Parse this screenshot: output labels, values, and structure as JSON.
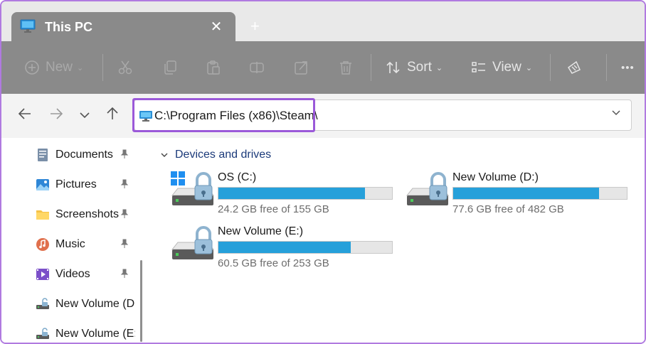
{
  "tab": {
    "title": "This PC",
    "close": "✕",
    "new_tab": "+"
  },
  "toolbar": {
    "new_label": "New",
    "sort_label": "Sort",
    "view_label": "View",
    "more_label": "•••"
  },
  "address": {
    "path": "C:\\Program Files (x86)\\Steam\\"
  },
  "sidebar": {
    "items": [
      {
        "label": "Documents",
        "icon": "documents-icon",
        "pinned": true
      },
      {
        "label": "Pictures",
        "icon": "pictures-icon",
        "pinned": true
      },
      {
        "label": "Screenshots",
        "icon": "folder-icon",
        "pinned": true
      },
      {
        "label": "Music",
        "icon": "music-icon",
        "pinned": true
      },
      {
        "label": "Videos",
        "icon": "videos-icon",
        "pinned": true
      },
      {
        "label": "New Volume (D",
        "icon": "drive-icon",
        "pinned": false
      },
      {
        "label": "New Volume (E:",
        "icon": "drive-icon",
        "pinned": false
      }
    ]
  },
  "main": {
    "group_title": "Devices and drives",
    "drives": [
      {
        "name": "OS (C:)",
        "free_text": "24.2 GB free of 155 GB",
        "free_gb": 24.2,
        "total_gb": 155,
        "windows_logo": true
      },
      {
        "name": "New Volume (D:)",
        "free_text": "77.6 GB free of 482 GB",
        "free_gb": 77.6,
        "total_gb": 482,
        "windows_logo": false
      },
      {
        "name": "New Volume (E:)",
        "free_text": "60.5 GB free of 253 GB",
        "free_gb": 60.5,
        "total_gb": 253,
        "windows_logo": false
      }
    ]
  },
  "colors": {
    "accent": "#26a0da",
    "highlight": "#9b59d9",
    "toolbar_bg": "#8a8a8a"
  }
}
